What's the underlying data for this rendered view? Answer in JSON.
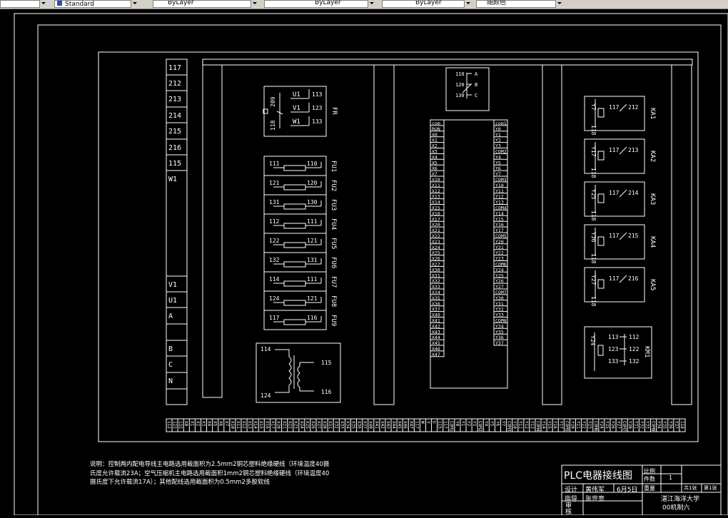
{
  "toolbar": {
    "textstyle": "Standard",
    "layer": "ByLayer",
    "linetype": "ByLayer",
    "lineweight": "ByLayer",
    "plotstyle": "随颜色"
  },
  "left_terminals": [
    "117",
    "212",
    "213",
    "214",
    "215",
    "216",
    "115",
    "W1",
    "V1",
    "U1",
    "A",
    "B",
    "C",
    "N"
  ],
  "fr": {
    "tag": "FR",
    "left_top": "209",
    "left_bottom": "118",
    "rows": [
      [
        "U1",
        "113"
      ],
      [
        "V1",
        "123"
      ],
      [
        "W1",
        "133"
      ]
    ]
  },
  "fuses": [
    {
      "tag": "FU1",
      "a": "111",
      "b": "110"
    },
    {
      "tag": "FU2",
      "a": "121",
      "b": "120"
    },
    {
      "tag": "FU3",
      "a": "131",
      "b": "130"
    },
    {
      "tag": "FU4",
      "a": "112",
      "b": "111"
    },
    {
      "tag": "FU5",
      "a": "122",
      "b": "121"
    },
    {
      "tag": "FU6",
      "a": "132",
      "b": "131"
    },
    {
      "tag": "FU7",
      "a": "114",
      "b": "111"
    },
    {
      "tag": "FU8",
      "a": "124",
      "b": "121"
    },
    {
      "tag": "FU9",
      "a": "117",
      "b": "116"
    }
  ],
  "transformer": {
    "tl": "114",
    "bl": "124",
    "tr": "115",
    "br": "116"
  },
  "switch": {
    "rows": [
      [
        "110",
        "A"
      ],
      [
        "120",
        "B"
      ],
      [
        "130",
        "C"
      ]
    ]
  },
  "plc": {
    "left": [
      "com",
      "RUN",
      "X0",
      "X1",
      "X2",
      "X3",
      "X4",
      "X5",
      "X6",
      "X7",
      "X10",
      "X11",
      "X12",
      "X13",
      "X14",
      "X15",
      "X16",
      "X17",
      "X20",
      "X21",
      "X22",
      "X23",
      "X24",
      "X25",
      "X26",
      "X27",
      "X30",
      "X31",
      "X32",
      "X33",
      "X34",
      "X35",
      "X36",
      "X37",
      "X40",
      "X41",
      "X42",
      "X43",
      "X44",
      "X45",
      "X46",
      "X47"
    ],
    "right": [
      "com1",
      "Y0",
      "Y1",
      "Y2",
      "Y3",
      "COM2",
      "Y4",
      "Y5",
      "Y6",
      "Y7",
      "COM3",
      "Y10",
      "Y11",
      "Y12",
      "Y13",
      "COM4",
      "Y14",
      "Y15",
      "Y16",
      "Y17",
      "COM5",
      "Y20",
      "Y21",
      "Y22",
      "Y23",
      "COM6",
      "Y24",
      "Y25",
      "Y26",
      "Y27",
      "COM7",
      "Y30",
      "Y31",
      "Y32",
      "Y33",
      "COM8",
      "Y34",
      "Y35",
      "Y36",
      "Y37"
    ]
  },
  "relays": [
    {
      "tag": "KA1",
      "y": "Y7",
      "a": "117",
      "b": "212",
      "n": "118"
    },
    {
      "tag": "KA2",
      "y": "Y17",
      "a": "117",
      "b": "213",
      "n": "118"
    },
    {
      "tag": "KA3",
      "y": "Y25",
      "a": "117",
      "b": "214",
      "n": "118"
    },
    {
      "tag": "KA4",
      "y": "Y36",
      "a": "117",
      "b": "215",
      "n": "118"
    },
    {
      "tag": "KA5",
      "y": "Y27",
      "a": "117",
      "b": "216",
      "n": "118"
    }
  ],
  "km1": {
    "tag": "KM1",
    "y": "Y24",
    "rows": [
      [
        "113",
        "112"
      ],
      [
        "123",
        "122"
      ],
      [
        "133",
        "132"
      ]
    ]
  },
  "bottom_strip": [
    "112",
    "122",
    "132",
    "X0",
    "X1",
    "X2",
    "X3",
    "X4",
    "X5",
    "X6",
    "X7",
    "X10",
    "X11",
    "X12",
    "X13",
    "X14",
    "X15",
    "X16",
    "X17",
    "X20",
    "X21",
    "X22",
    "X23",
    "X24",
    "X25",
    "X26",
    "X27",
    "X30",
    "X31",
    "X32",
    "X33",
    "X34",
    "X35",
    "X36",
    "X37",
    "X40",
    "X41",
    "X42",
    "X43",
    "X44",
    "X45",
    "X46",
    "X47",
    "117",
    "W",
    "V",
    "U",
    "115",
    "117",
    "COM1",
    "Y0",
    "Y1",
    "Y2",
    "Y3",
    "COM2",
    "Y4",
    "Y5",
    "Y6",
    "Y7",
    "COM3",
    "Y10",
    "Y11",
    "Y12",
    "Y13",
    "COM4",
    "Y14",
    "Y15",
    "Y16",
    "Y17",
    "COM5",
    "Y20",
    "Y21",
    "Y22",
    "Y23",
    "COM6",
    "Y24",
    "Y25",
    "Y26",
    "Y27",
    "COM7",
    "Y30",
    "Y31",
    "Y32",
    "Y33",
    "COM8",
    "Y34",
    "Y35",
    "Y36",
    "Y37",
    "118"
  ],
  "note": "说明：控制两内配电导线主电路选用截面积为2.5mm2铜芯塑料绝缘硬线（环境温度40摄氏度允许载流23A；空气压缩机主电路选用截面积1mm2铜芯塑料绝缘硬线（环境温度40摄氏度下允许载流17A）；其他配线选用截面积为0.5mm2多股软线",
  "title_block": {
    "title": "PLC电器接线图",
    "scale_label": "比例",
    "count_label": "件数",
    "count_value": "1",
    "weight_label": "重量",
    "sheets_total": "共1张",
    "sheet_no": "第1张",
    "design_label": "设计",
    "designer": "黄伟军",
    "date": "6月5日",
    "guide_label": "指导",
    "guide": "张世亮",
    "school": "湛江海洋大学",
    "class": "00机制六",
    "review_label": "审核"
  }
}
